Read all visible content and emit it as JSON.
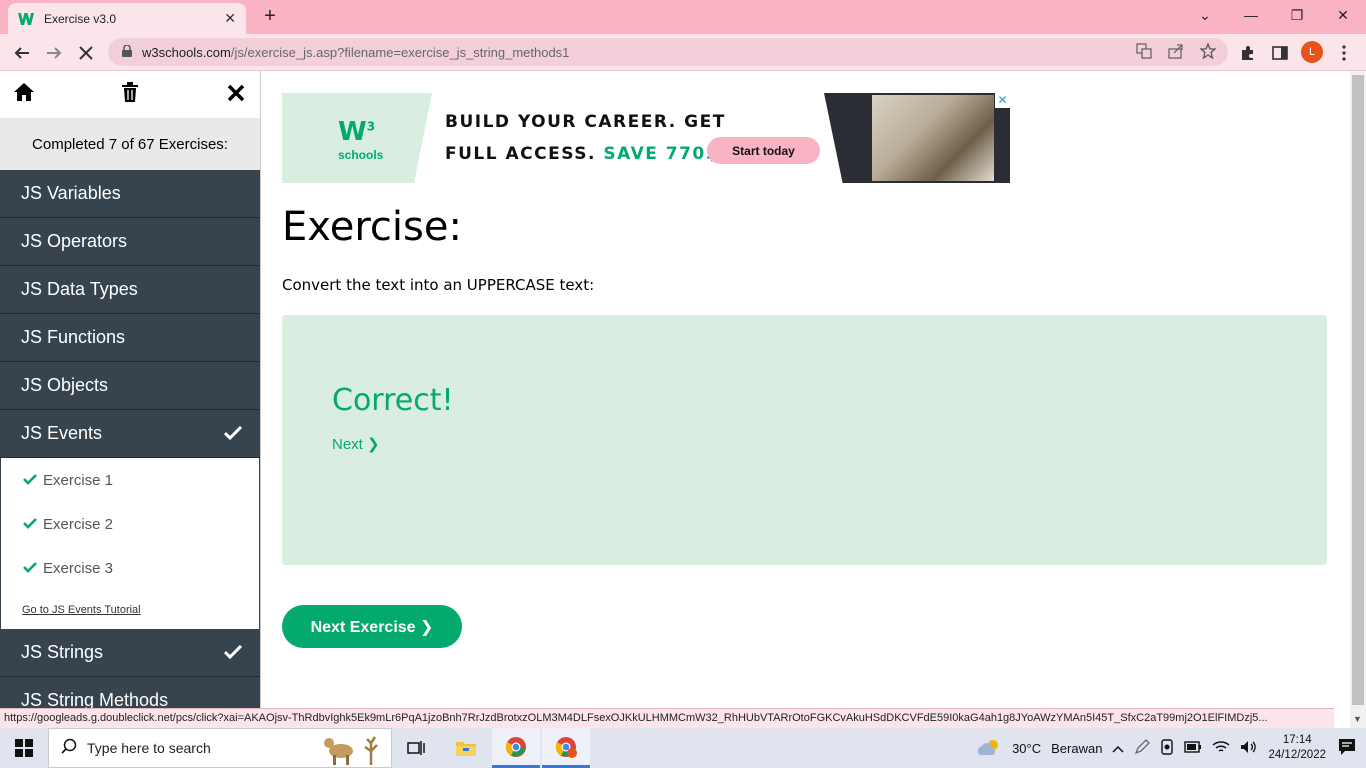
{
  "browser": {
    "tab_title": "Exercise v3.0",
    "tab_close": "✕",
    "new_tab": "+",
    "url_host": "w3schools.com",
    "url_path": "/js/exercise_js.asp?filename=exercise_js_string_methods1",
    "profile_initial": "L",
    "window_controls": [
      "⌄",
      "—",
      "❐",
      "✕"
    ]
  },
  "sidebar": {
    "completed_text": "Completed 7 of 67 Exercises:",
    "categories": [
      {
        "label": "JS Variables"
      },
      {
        "label": "JS Operators"
      },
      {
        "label": "JS Data Types"
      },
      {
        "label": "JS Functions"
      },
      {
        "label": "JS Objects"
      },
      {
        "label": "JS Events",
        "checked": true
      },
      {
        "label": "JS Strings",
        "checked": true
      },
      {
        "label": "JS String Methods"
      }
    ],
    "events_exercises": [
      "Exercise 1",
      "Exercise 2",
      "Exercise 3"
    ],
    "tutorial_link": "Go to JS Events Tutorial"
  },
  "ad": {
    "logo_w": "W",
    "logo_sup": "3",
    "logo_text": "schools",
    "line1": "BUILD YOUR CAREER. GET",
    "line2_prefix": "FULL ACCESS.",
    "line2_save": "SAVE 770$",
    "button": "Start today",
    "close": "✕"
  },
  "exercise": {
    "heading": "Exercise:",
    "instruction": "Convert the text into an UPPERCASE text:",
    "result_title": "Correct!",
    "next_link": "Next ❯",
    "next_button": "Next Exercise ❯"
  },
  "status_url": "https://googleads.g.doubleclick.net/pcs/click?xai=AKAOjsv-ThRdbvIghk5Ek9mLr6PqA1jzoBnh7RrJzdBrotxzOLM3M4DLFsexOJKkULHMMCmW32_RhHUbVTARrOtoFGKCvAkuHSdDKCVFdE59I0kaG4ah1g8JYoAWzYMAn5I45T_SfxC2aT99mj2O1ElFIMDzj5...",
  "taskbar": {
    "search_placeholder": "Type here to search",
    "temperature": "30°C",
    "weather": "Berawan",
    "time": "17:14",
    "date": "24/12/2022"
  },
  "colors": {
    "accent": "#04aa6d",
    "sidebar_bg": "#38444d",
    "result_bg": "#d9eee1",
    "chrome_pink": "#f9b3c3"
  }
}
